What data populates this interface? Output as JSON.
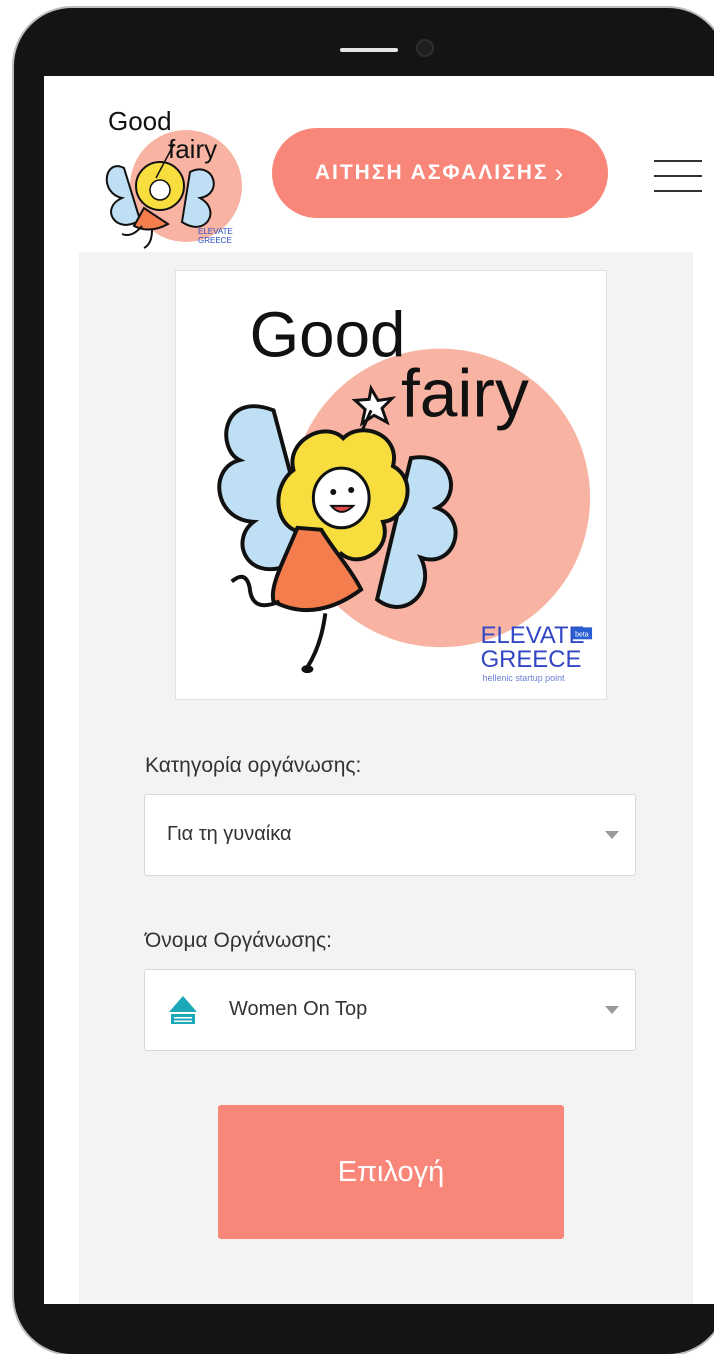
{
  "header": {
    "logo": {
      "line1": "Good",
      "line2": "fairy",
      "badge_line1": "ELEVATE",
      "badge_line2": "GREECE"
    },
    "cta_label": "ΑΙΤΗΣΗ ΑΣΦΑΛΙΣΗΣ",
    "cta_icon": "chevron-right-icon",
    "menu_icon": "hamburger-icon"
  },
  "hero_logo": {
    "line1": "Good",
    "line2": "fairy",
    "badge_line1": "ELEVATE",
    "badge_tag": "beta",
    "badge_line2": "GREECE",
    "badge_caption": "hellenic startup point"
  },
  "form": {
    "category_label": "Κατηγορία οργάνωσης:",
    "category_value": "Για τη γυναίκα",
    "org_label": "Όνομα Οργάνωσης:",
    "org_value": "Women On Top",
    "org_icon": "women-on-top-logo-icon",
    "submit_label": "Επιλογή"
  },
  "colors": {
    "accent": "#f8877a",
    "panel_bg": "#f3f3f3",
    "fairy_circle": "#f8b3a2",
    "wing_blue": "#bfe0f4",
    "hair_yellow": "#f7de3e",
    "dress_orange": "#f37d4d"
  }
}
